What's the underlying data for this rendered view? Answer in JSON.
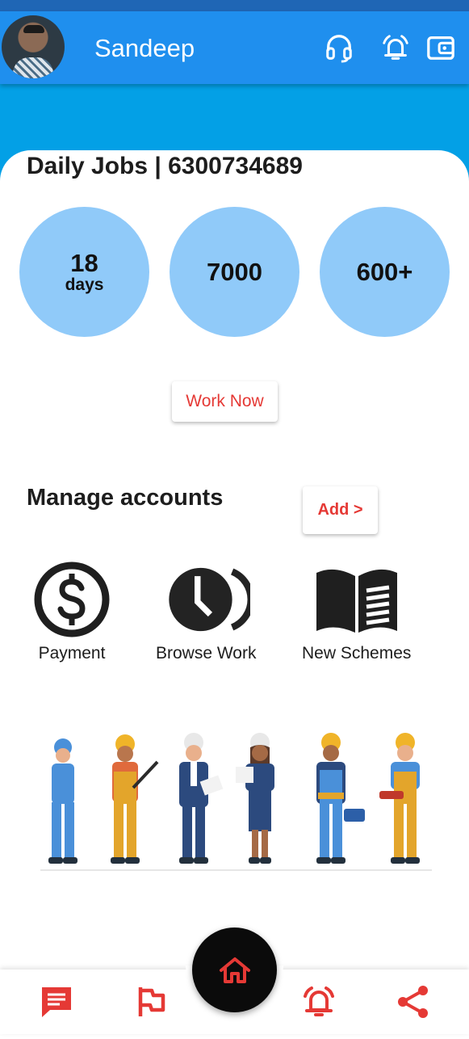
{
  "header": {
    "username": "Sandeep",
    "icons": [
      "headset-icon",
      "alarm-icon",
      "wallet-icon"
    ],
    "bar_color": "#1f8fee"
  },
  "daily": {
    "title": "Daily Jobs | 6300734689",
    "stats": [
      {
        "value": "18",
        "unit": "days"
      },
      {
        "value": "7000",
        "unit": ""
      },
      {
        "value": "600+",
        "unit": ""
      }
    ],
    "work_now_label": "Work Now"
  },
  "manage": {
    "title": "Manage accounts",
    "add_label": "Add >",
    "items": [
      {
        "label": "Payment",
        "icon": "dollar-icon"
      },
      {
        "label": "Browse Work",
        "icon": "clock-icon"
      },
      {
        "label": "New Schemes",
        "icon": "book-icon"
      }
    ]
  },
  "bottom_nav": {
    "items": [
      "chat-icon",
      "flag-icon",
      "home-icon",
      "alarm-icon",
      "share-icon"
    ],
    "accent": "#e53935"
  }
}
